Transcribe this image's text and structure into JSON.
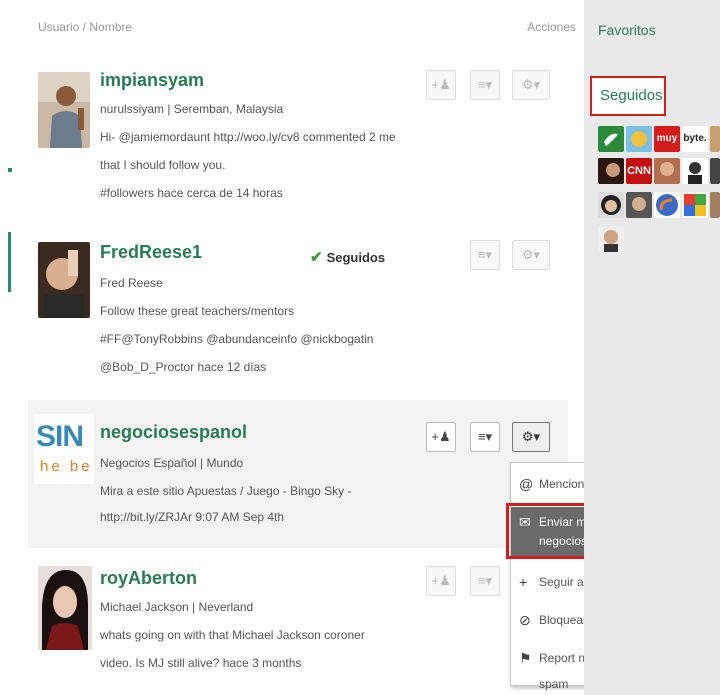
{
  "header": {
    "user_col": "Usuario / Nombre",
    "actions_col": "Acciones"
  },
  "users": [
    {
      "username": "impiansyam",
      "meta": "nurulssiyam | Seremban, Malaysia",
      "lines": [
        "Hi- @jamiemordaunt http://woo.ly/cv8 commented 2 me",
        "that I should follow you.",
        "#followers  hace cerca de 14 horas"
      ]
    },
    {
      "username": "FredReese1",
      "status": "Seguidos",
      "meta": "Fred Reese",
      "lines": [
        "Follow these great teachers/mentors",
        "#FF@TonyRobbins @abundanceinfo @nickbogatin",
        "@Bob_D_Proctor  hace 12 días"
      ]
    },
    {
      "username": "negociosespanol",
      "meta": "Negocios Español | Mundo",
      "lines": [
        "Mira a este sitio Apuestas / Juego - Bingo Sky -",
        "http://bit.ly/ZRJAr  9:07 AM Sep 4th"
      ],
      "avatar_text_top": "SIN",
      "avatar_text_bottom": "he be"
    },
    {
      "username": "royAberton",
      "meta": "Michael Jackson | Neverland",
      "lines": [
        "whats going on with that Michael Jackson coroner",
        "video. Is MJ still alive?  hace 3 months"
      ]
    }
  ],
  "dropdown": {
    "items": [
      {
        "icon": "@",
        "label": "Mencionar a negociosespanol"
      },
      {
        "icon": "✉",
        "label_1": "Enviar mensaje directo a",
        "label_2": "negociosespanol"
      },
      {
        "icon": "+",
        "label": "Seguir a negociosespanol"
      },
      {
        "icon": "⊘",
        "label": "Bloquear negociosespanol"
      },
      {
        "icon": "⚑",
        "label": "Report negociosespanol for spam"
      }
    ]
  },
  "sidebar": {
    "favorites": "Favoritos",
    "following": "Seguidos",
    "thumb_texts": {
      "muy": "muy",
      "byte": "byte.",
      "cnn": "CNN"
    }
  },
  "colors": {
    "accent_green": "#2a7a55",
    "highlight_red": "#d41c1c",
    "selected_bg": "#6a6a6a"
  }
}
